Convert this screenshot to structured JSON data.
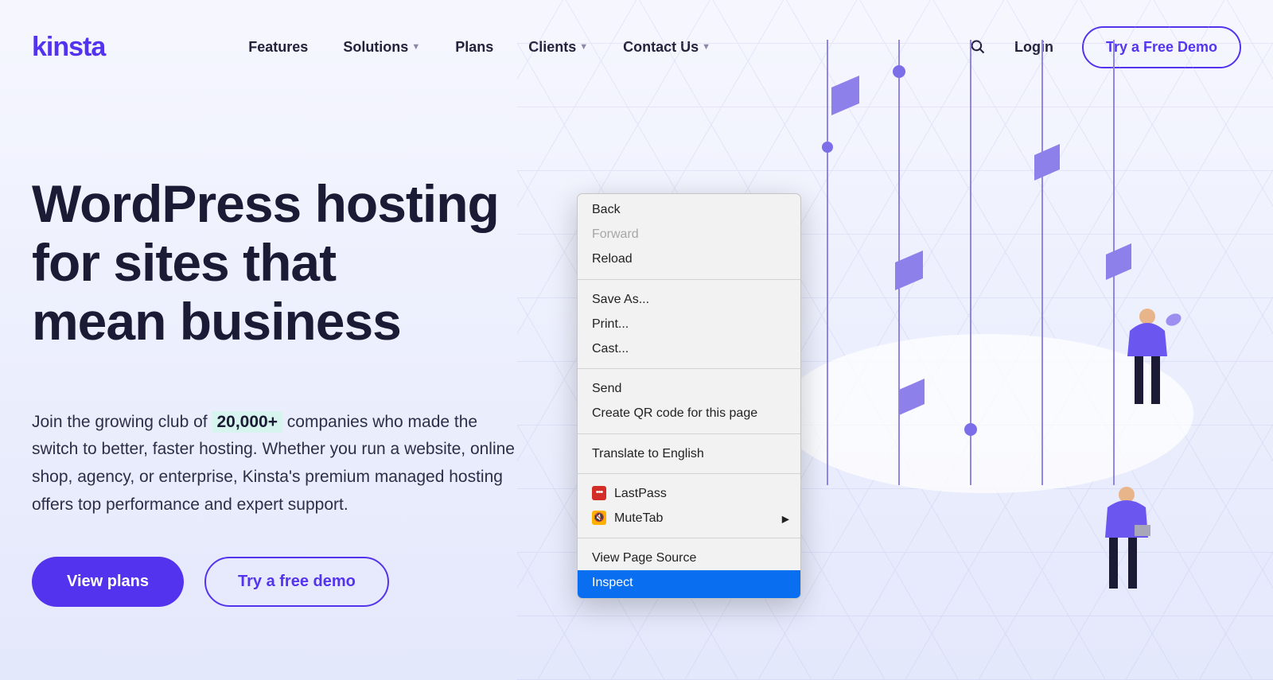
{
  "brand": "kinsta",
  "nav": {
    "features": "Features",
    "solutions": "Solutions",
    "plans": "Plans",
    "clients": "Clients",
    "contact": "Contact Us"
  },
  "header_right": {
    "login": "Login",
    "demo": "Try a Free Demo"
  },
  "hero": {
    "title_line1": "WordPress hosting",
    "title_line2": "for sites that",
    "title_line3": "mean business",
    "sub_part1": "Join the growing club of ",
    "sub_highlight": "20,000+",
    "sub_part2": " companies who made the switch to better, faster hosting. Whether you run a website, online shop, agency, or enterprise, Kinsta's premium managed hosting offers top performance and expert support.",
    "cta_primary": "View plans",
    "cta_secondary": "Try a free demo"
  },
  "context_menu": {
    "back": "Back",
    "forward": "Forward",
    "reload": "Reload",
    "save_as": "Save As...",
    "print": "Print...",
    "cast": "Cast...",
    "send": "Send",
    "create_qr": "Create QR code for this page",
    "translate": "Translate to English",
    "ext_lastpass": "LastPass",
    "ext_mutetab": "MuteTab",
    "view_source": "View Page Source",
    "inspect": "Inspect"
  },
  "colors": {
    "accent": "#5333ED",
    "menu_highlight": "#0a6ef0"
  }
}
